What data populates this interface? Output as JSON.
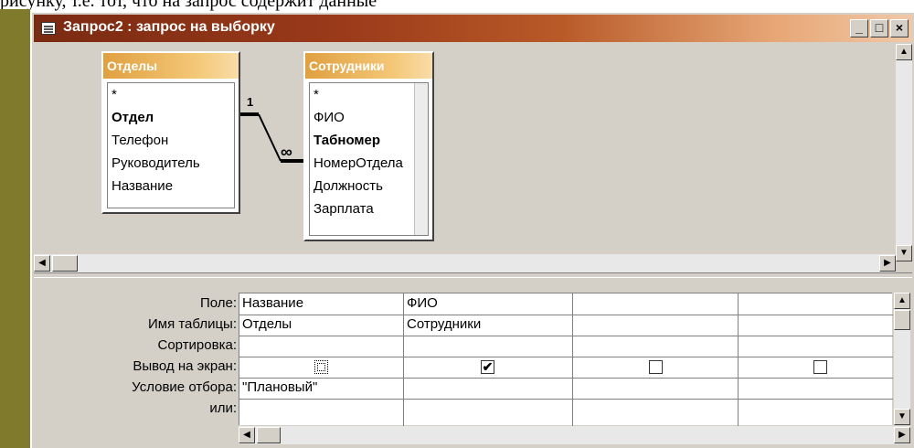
{
  "doc_fragment": "рисунку, т.е. тот, что на запрос содержит данные",
  "window": {
    "title": "Запрос2 : запрос на выборку",
    "minimize": "_",
    "maximize": "□",
    "close": "×"
  },
  "tables": [
    {
      "name": "Отделы",
      "fields": [
        "*",
        "Отдел",
        "Телефон",
        "Руководитель",
        "Название"
      ],
      "key_index": 1
    },
    {
      "name": "Сотрудники",
      "fields": [
        "*",
        "ФИО",
        "Табномер",
        "НомерОтдела",
        "Должность",
        "Зарплата"
      ],
      "key_index": 2
    }
  ],
  "relationship": {
    "one": "1",
    "many": "∞"
  },
  "grid": {
    "row_labels": [
      "Поле:",
      "Имя таблицы:",
      "Сортировка:",
      "Вывод на экран:",
      "Условие отбора:",
      "или:"
    ],
    "columns": [
      {
        "field": "Название",
        "table": "Отделы",
        "sort": "",
        "show": true,
        "criteria": "\"Плановый\"",
        "or": ""
      },
      {
        "field": "ФИО",
        "table": "Сотрудники",
        "sort": "",
        "show": true,
        "criteria": "",
        "or": ""
      },
      {
        "field": "",
        "table": "",
        "sort": "",
        "show": false,
        "criteria": "",
        "or": ""
      },
      {
        "field": "",
        "table": "",
        "sort": "",
        "show": false,
        "criteria": "",
        "or": ""
      }
    ]
  },
  "checkmark": "✔"
}
